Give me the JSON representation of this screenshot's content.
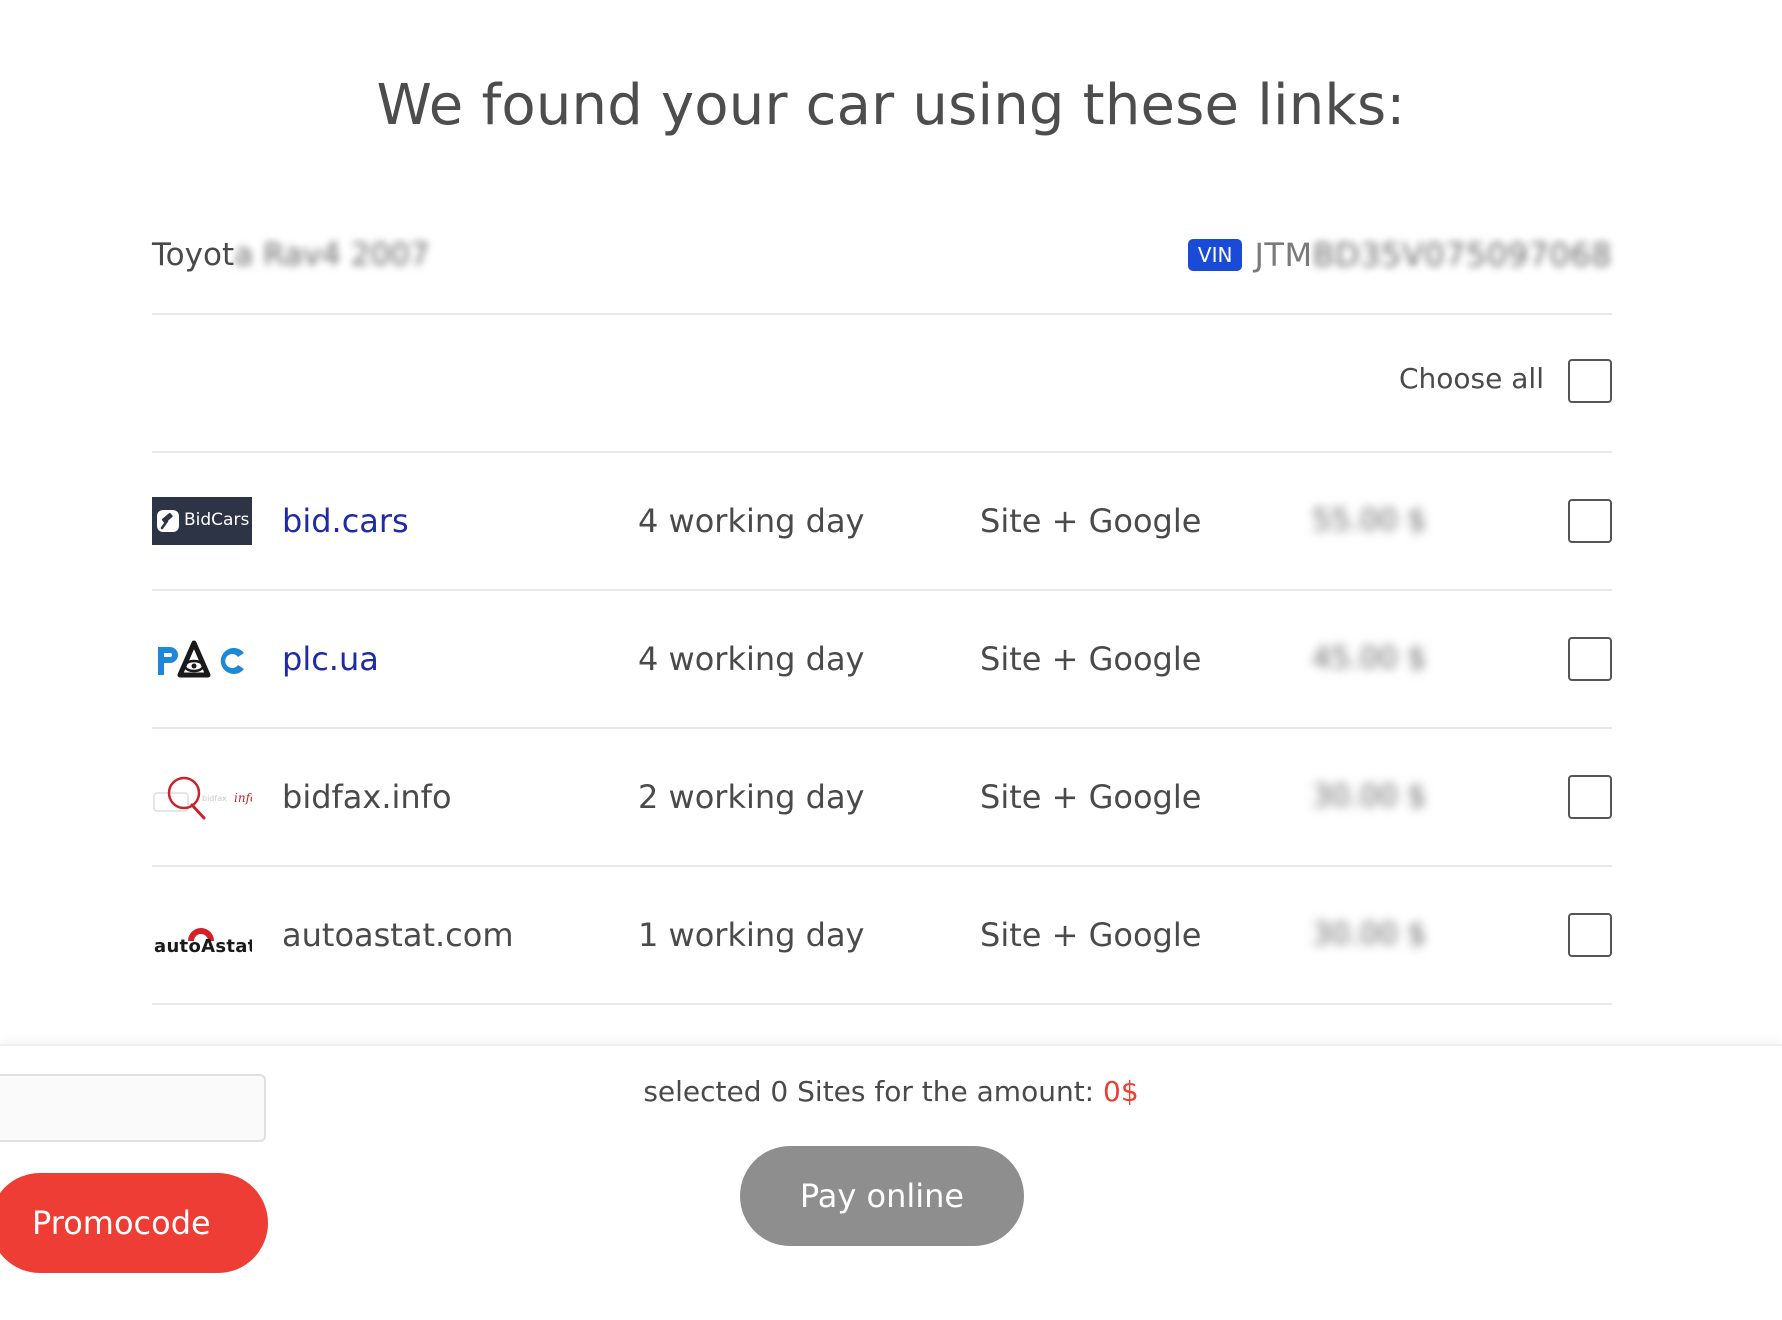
{
  "page": {
    "title": "We found your car using these links:"
  },
  "car": {
    "make_visible": "Toyot",
    "make_blurred": "a Rav4 2007",
    "vin_label": "VIN",
    "vin_visible": "JTM",
    "vin_blurred": "BD35V075097068"
  },
  "selection": {
    "choose_all_label": "Choose all"
  },
  "sites": [
    {
      "logo": "bidcars-logo",
      "logo_text": "BidCars",
      "name": "bid.cars",
      "linked": true,
      "delivery": "4 working day",
      "coverage": "Site + Google",
      "price": "55.00 $"
    },
    {
      "logo": "plc-logo",
      "name": "plc.ua",
      "linked": true,
      "delivery": "4 working day",
      "coverage": "Site + Google",
      "price": "45.00 $"
    },
    {
      "logo": "bidfax-logo",
      "logo_text": "info",
      "name": "bidfax.info",
      "linked": false,
      "delivery": "2 working day",
      "coverage": "Site + Google",
      "price": "30.00 $"
    },
    {
      "logo": "autoastat-logo",
      "logo_text": "autoAstat",
      "name": "autoastat.com",
      "linked": false,
      "delivery": "1 working day",
      "coverage": "Site + Google",
      "price": "30.00 $"
    }
  ],
  "footer": {
    "summary_prefix": "selected 0 Sites for the amount: ",
    "summary_amount": "0$",
    "pay_label": "Pay online",
    "promo_label": "Promocode",
    "promo_input_value": ""
  },
  "colors": {
    "accent_red": "#ee3d34",
    "link_blue": "#1e2aa8",
    "vin_badge": "#1a4bd6",
    "pay_disabled": "#8e8e8e"
  }
}
